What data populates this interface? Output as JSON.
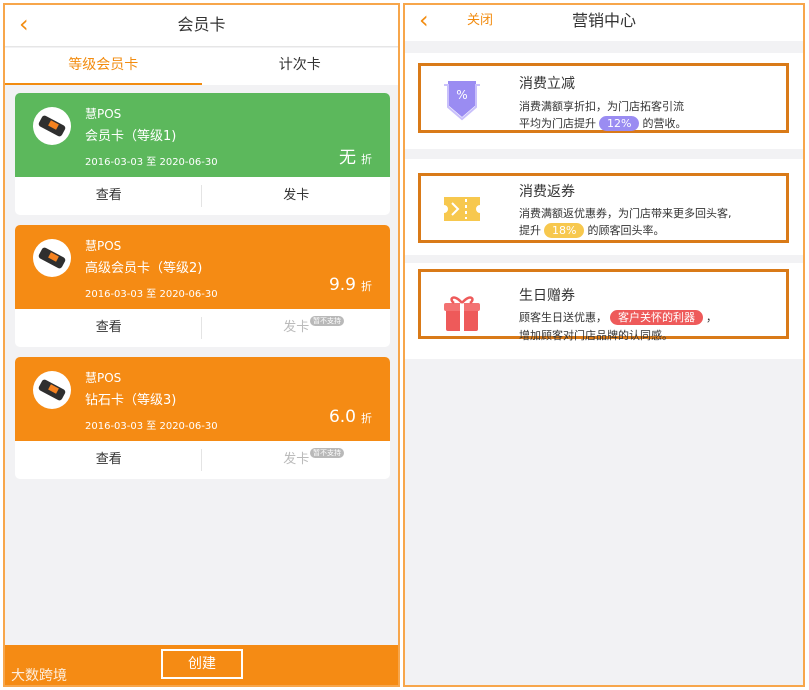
{
  "colors": {
    "accent": "#f28c10",
    "green": "#5cb85c",
    "orange": "#f58b14",
    "purple": "#9a8cf2",
    "yellow": "#f7c84e",
    "red": "#ee5a5a"
  },
  "left": {
    "nav": {
      "back_icon": "‹",
      "title": "会员卡"
    },
    "tabs": [
      {
        "label": "等级会员卡",
        "active": true
      },
      {
        "label": "计次卡",
        "active": false
      }
    ],
    "cards": [
      {
        "brand": "慧POS",
        "name": "会员卡（等级1)",
        "dates": "2016-03-03 至 2020-06-30",
        "discount": "无",
        "discount_unit": "折",
        "color": "#5cb85c",
        "view_label": "查看",
        "issue_label": "发卡",
        "issue_enabled": true,
        "badge": ""
      },
      {
        "brand": "慧POS",
        "name": "高级会员卡（等级2)",
        "dates": "2016-03-03 至 2020-06-30",
        "discount": "9.9",
        "discount_unit": "折",
        "color": "#f58b14",
        "view_label": "查看",
        "issue_label": "发卡",
        "issue_enabled": false,
        "badge": "暂不支持"
      },
      {
        "brand": "慧POS",
        "name": "钻石卡（等级3)",
        "dates": "2016-03-03 至 2020-06-30",
        "discount": "6.0",
        "discount_unit": "折",
        "color": "#f58b14",
        "view_label": "查看",
        "issue_label": "发卡",
        "issue_enabled": false,
        "badge": "暂不支持"
      }
    ],
    "create_label": "创建",
    "watermark": "大数跨境"
  },
  "right": {
    "nav": {
      "back_icon": "‹",
      "close_label": "关闭",
      "title": "营销中心"
    },
    "promos": [
      {
        "title": "消费立减",
        "line1": "消费满额享折扣，为门店拓客引流",
        "line2_pre": "平均为门店提升",
        "pill": "12%",
        "line2_post": "的营收。",
        "pill_color": "#9a8cf2",
        "icon": "discount-coupon-icon"
      },
      {
        "title": "消费返券",
        "line1": "消费满额返优惠券，为门店带来更多回头客,",
        "line2_pre": "提升",
        "pill": "18%",
        "line2_post": "的顾客回头率。",
        "pill_color": "#f7c84e",
        "icon": "ticket-icon"
      },
      {
        "title": "生日赠券",
        "line1_pre": "顾客生日送优惠，",
        "pill": "客户关怀的利器",
        "line1_post": "，",
        "line2": "增加顾客对门店品牌的认同感。",
        "pill_color": "#ee5a5a",
        "icon": "gift-icon"
      }
    ]
  }
}
